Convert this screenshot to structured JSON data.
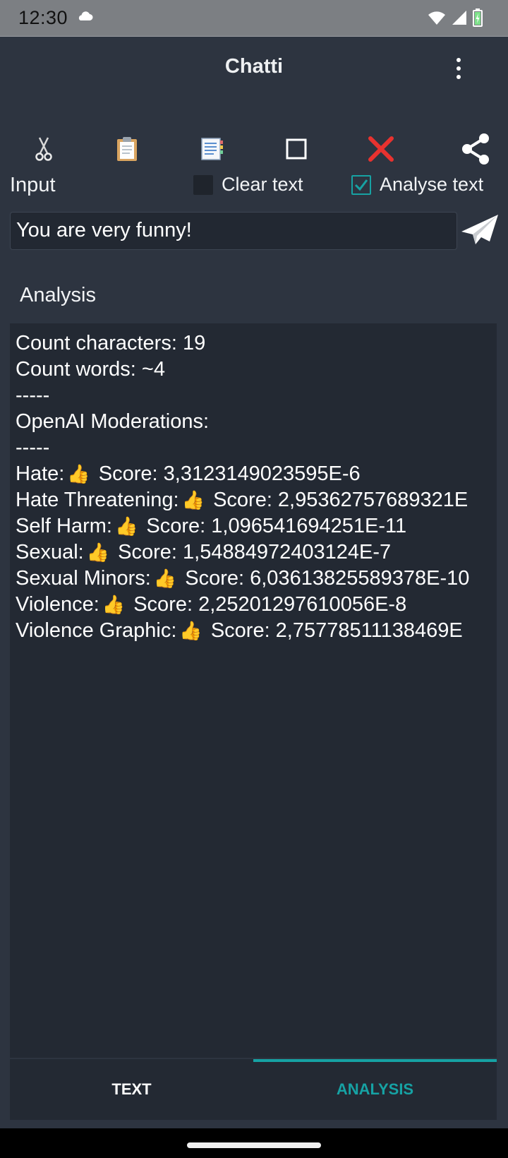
{
  "status_bar": {
    "time": "12:30",
    "icons": [
      "cloud-icon",
      "wifi-icon",
      "signal-icon",
      "battery-icon"
    ]
  },
  "app_bar": {
    "title": "Chatti",
    "menu_icon": "overflow-menu-icon"
  },
  "toolbar": {
    "items": [
      "cut-icon",
      "paste-icon",
      "copy-icon",
      "select-all-icon",
      "clear-icon",
      "share-icon"
    ]
  },
  "input_section": {
    "label": "Input",
    "clear_text": {
      "label": "Clear text",
      "checked": false
    },
    "analyse_text": {
      "label": "Analyse text",
      "checked": true
    },
    "input_value": "You are very funny!",
    "send_icon": "send-icon"
  },
  "analysis": {
    "label": "Analysis",
    "count_characters": "Count characters: 19",
    "count_words": "Count words: ~4",
    "separator": "-----",
    "moderations_title": "OpenAI Moderations:",
    "thumb_icon": "👍",
    "categories": [
      {
        "name": "Hate:",
        "score": "Score: 3,3123149023595E-6"
      },
      {
        "name": "Hate Threatening:",
        "score": "Score: 2,95362757689321E"
      },
      {
        "name": "Self Harm:",
        "score": "Score: 1,096541694251E-11"
      },
      {
        "name": "Sexual:",
        "score": "Score: 1,54884972403124E-7"
      },
      {
        "name": "Sexual Minors:",
        "score": "Score: 6,03613825589378E-10"
      },
      {
        "name": "Violence:",
        "score": "Score: 2,25201297610056E-8"
      },
      {
        "name": "Violence Graphic:",
        "score": "Score: 2,75778511138469E"
      }
    ]
  },
  "tabs": {
    "text": "TEXT",
    "analysis": "ANALYSIS",
    "active": "analysis"
  },
  "colors": {
    "background": "#2d3440",
    "panel": "#232933",
    "accent": "#16a2a4",
    "status_bar": "#7c7f83"
  }
}
